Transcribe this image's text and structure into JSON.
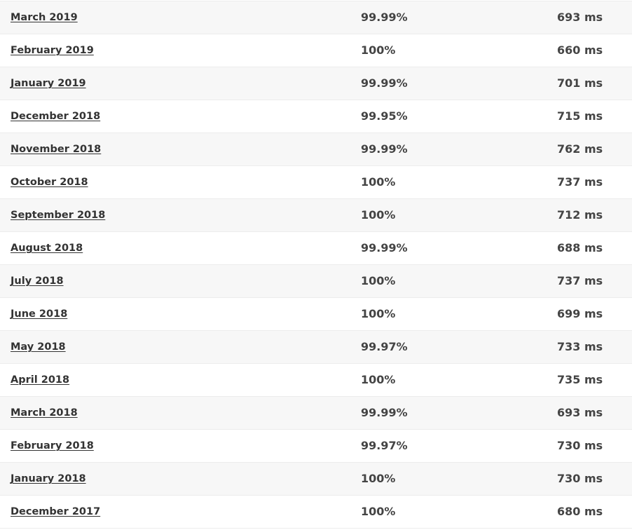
{
  "table": {
    "rows": [
      {
        "month": "March 2019",
        "uptime": "99.99%",
        "response": "693 ms"
      },
      {
        "month": "February 2019",
        "uptime": "100%",
        "response": "660 ms"
      },
      {
        "month": "January 2019",
        "uptime": "99.99%",
        "response": "701 ms"
      },
      {
        "month": "December 2018",
        "uptime": "99.95%",
        "response": "715 ms"
      },
      {
        "month": "November 2018",
        "uptime": "99.99%",
        "response": "762 ms"
      },
      {
        "month": "October 2018",
        "uptime": "100%",
        "response": "737 ms"
      },
      {
        "month": "September 2018",
        "uptime": "100%",
        "response": "712 ms"
      },
      {
        "month": "August 2018",
        "uptime": "99.99%",
        "response": "688 ms"
      },
      {
        "month": "July 2018",
        "uptime": "100%",
        "response": "737 ms"
      },
      {
        "month": "June 2018",
        "uptime": "100%",
        "response": "699 ms"
      },
      {
        "month": "May 2018",
        "uptime": "99.97%",
        "response": "733 ms"
      },
      {
        "month": "April 2018",
        "uptime": "100%",
        "response": "735 ms"
      },
      {
        "month": "March 2018",
        "uptime": "99.99%",
        "response": "693 ms"
      },
      {
        "month": "February 2018",
        "uptime": "99.97%",
        "response": "730 ms"
      },
      {
        "month": "January 2018",
        "uptime": "100%",
        "response": "730 ms"
      },
      {
        "month": "December 2017",
        "uptime": "100%",
        "response": "680 ms"
      }
    ]
  }
}
